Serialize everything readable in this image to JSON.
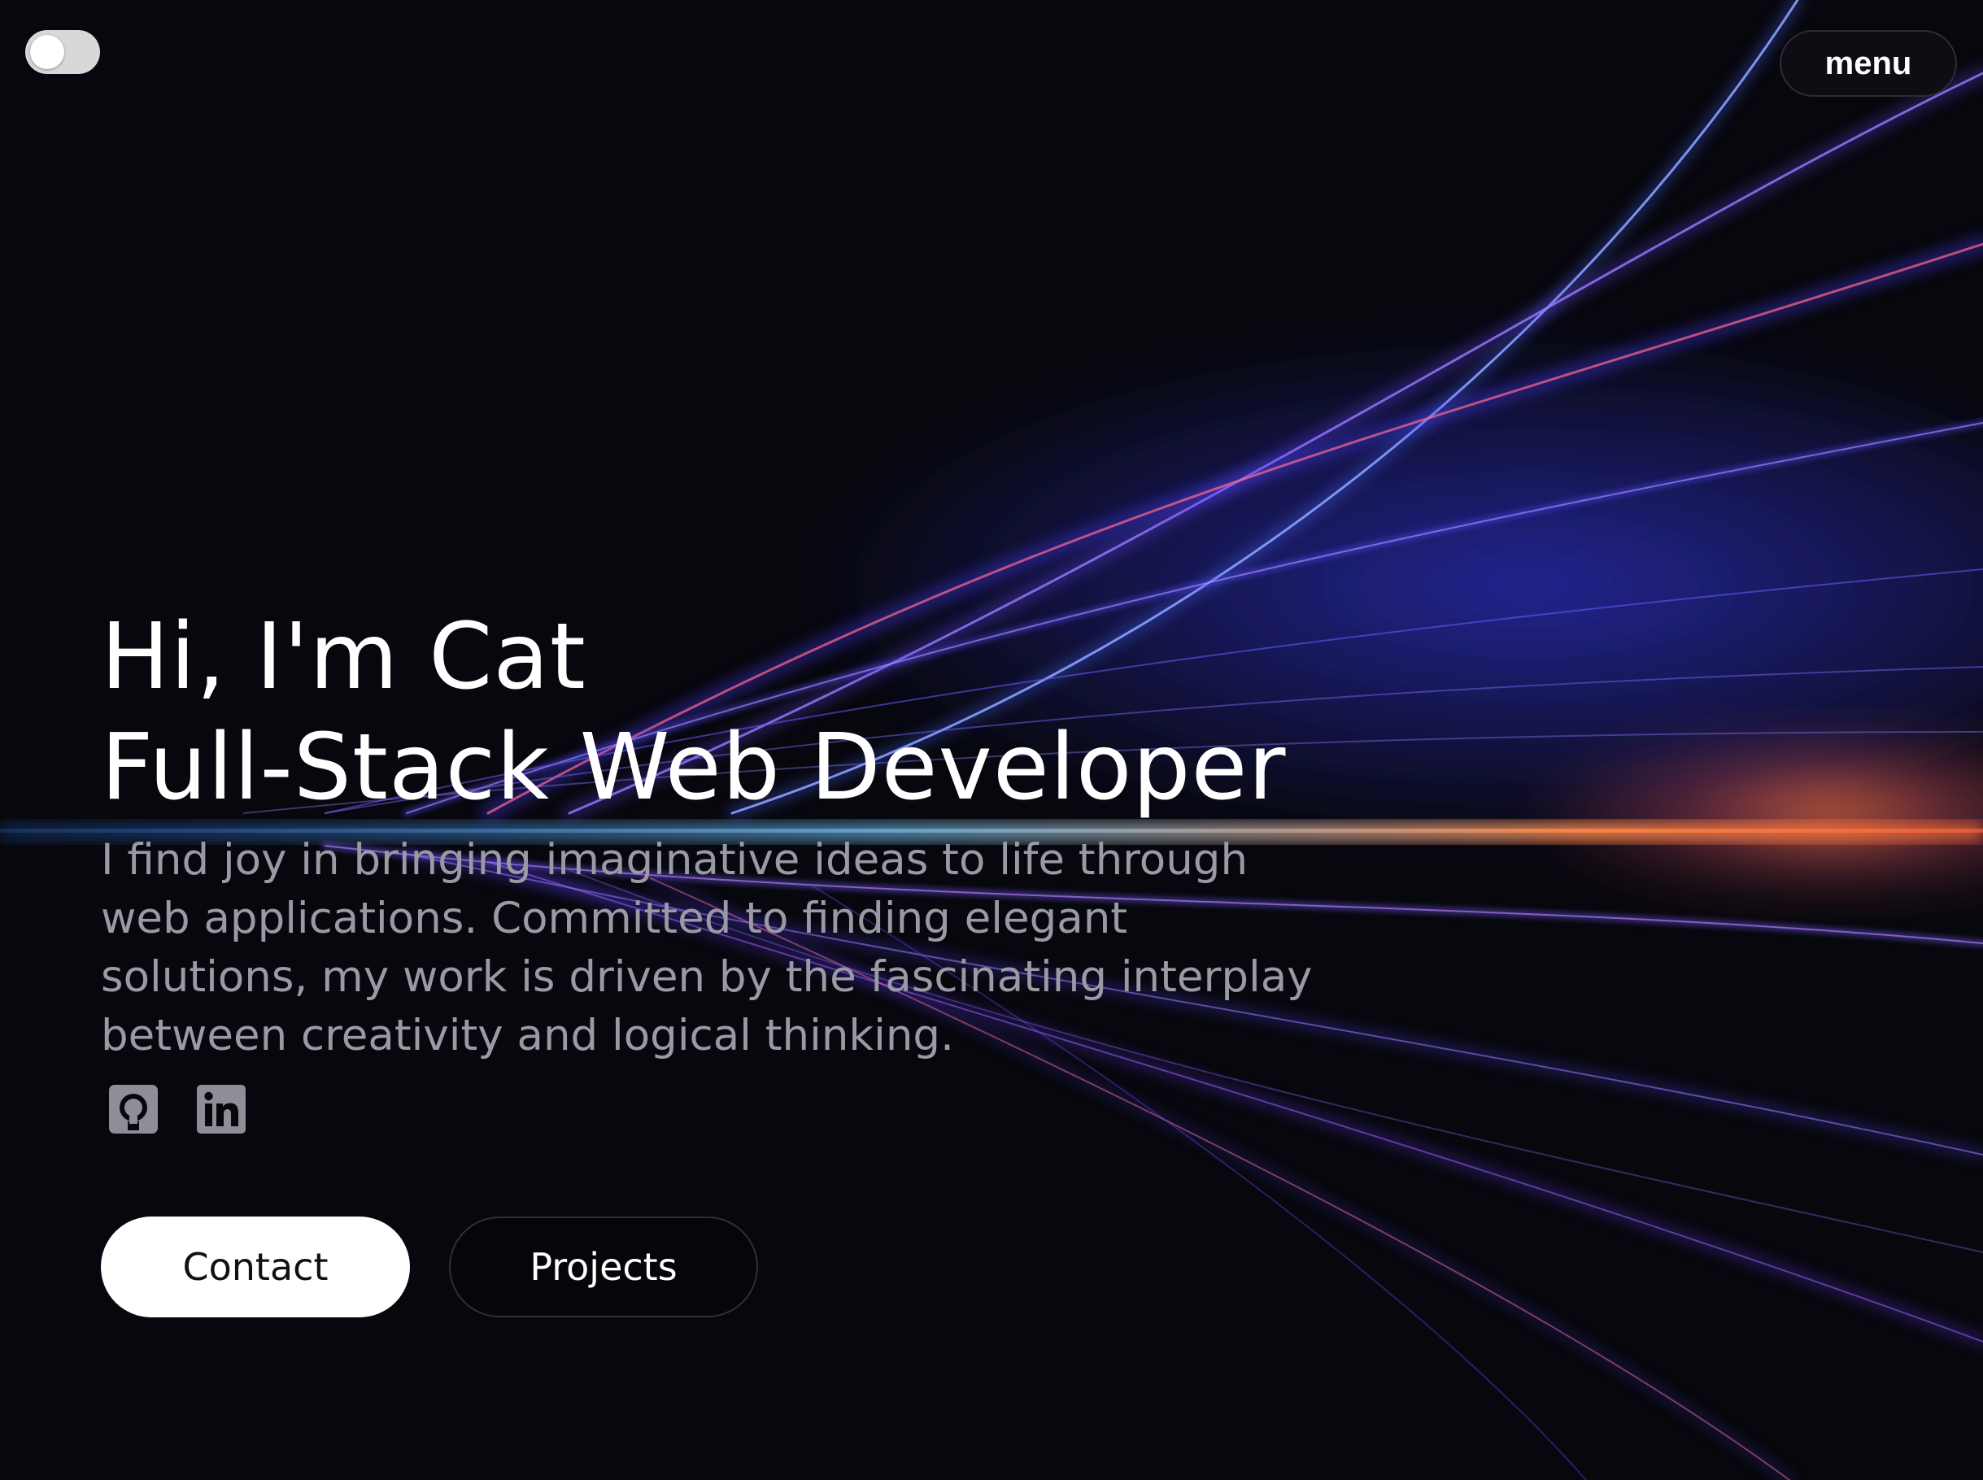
{
  "theme_toggle": {
    "state": "off"
  },
  "nav": {
    "menu_label": "menu"
  },
  "hero": {
    "greeting": "Hi, I'm Cat",
    "role": "Full-Stack Web Developer",
    "description": "I find joy in bringing imaginative ideas to life through web applications. Committed to finding elegant solutions, my work is driven by the fascinating interplay between creativity and logical thinking."
  },
  "socials": [
    {
      "icon": "github-icon"
    },
    {
      "icon": "linkedin-icon"
    }
  ],
  "buttons": {
    "contact_label": "Contact",
    "projects_label": "Projects"
  },
  "colors": {
    "background": "#07070d",
    "light_streak_blue": "#4a55ff",
    "light_streak_purple": "#8a4cff",
    "light_streak_orange": "#ff7a3c",
    "description_text": "#9a9aa4"
  }
}
